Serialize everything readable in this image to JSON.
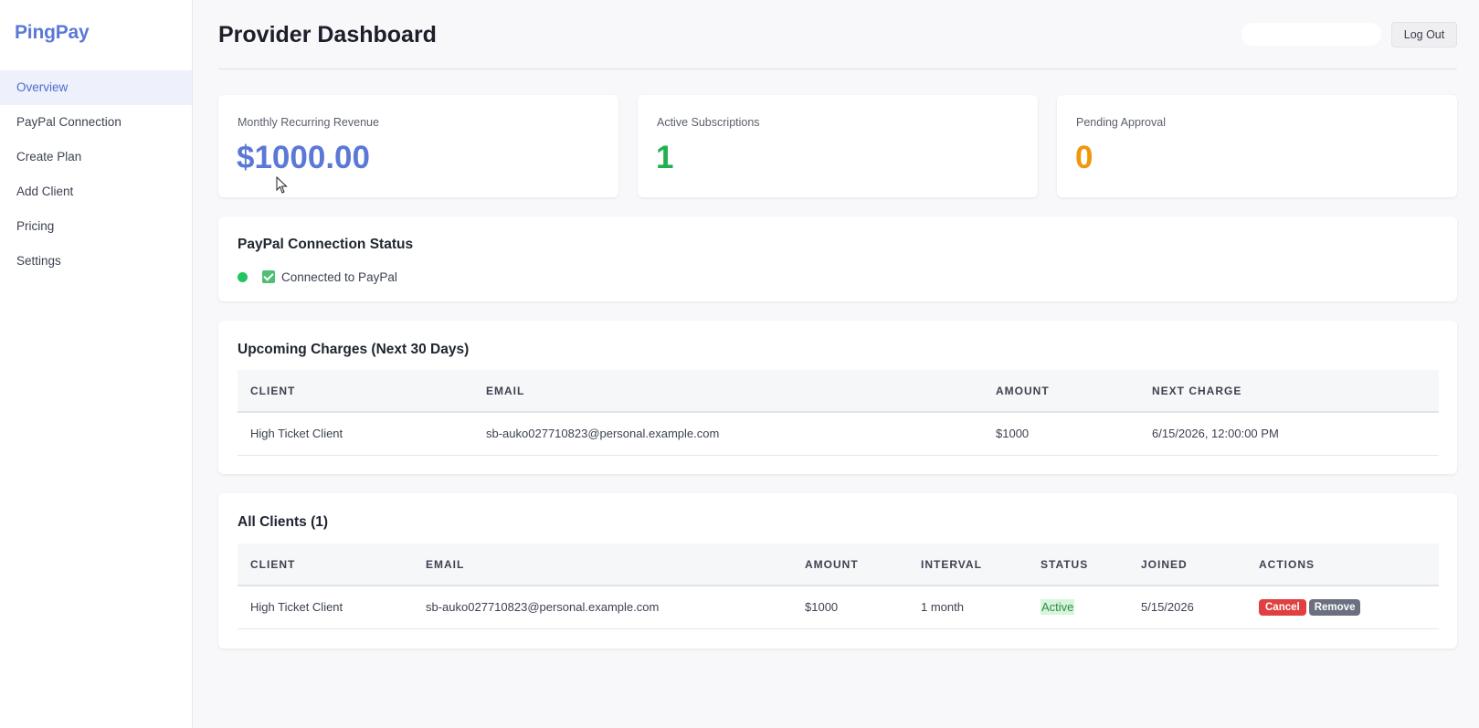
{
  "sidebar": {
    "brand": "PingPay",
    "items": [
      {
        "label": "Overview",
        "active": true
      },
      {
        "label": "PayPal Connection"
      },
      {
        "label": "Create Plan"
      },
      {
        "label": "Add Client"
      },
      {
        "label": "Pricing"
      },
      {
        "label": "Settings"
      }
    ]
  },
  "header": {
    "title": "Provider Dashboard",
    "logout_label": "Log Out"
  },
  "stats": [
    {
      "label": "Monthly Recurring Revenue",
      "value": "$1000.00",
      "color": "#5b78d8"
    },
    {
      "label": "Active Subscriptions",
      "value": "1",
      "color": "#22b04f"
    },
    {
      "label": "Pending Approval",
      "value": "0",
      "color": "#f0980c"
    }
  ],
  "paypal": {
    "title": "PayPal Connection Status",
    "status_text": "Connected to PayPal",
    "status_color": "#22c55e"
  },
  "upcoming": {
    "title": "Upcoming Charges (Next 30 Days)",
    "columns": [
      "CLIENT",
      "EMAIL",
      "AMOUNT",
      "NEXT CHARGE"
    ],
    "rows": [
      {
        "client": "High Ticket Client",
        "email": "sb-auko027710823@personal.example.com",
        "amount": "$1000",
        "next_charge": "6/15/2026, 12:00:00 PM"
      }
    ]
  },
  "clients": {
    "title": "All Clients (1)",
    "columns": [
      "CLIENT",
      "EMAIL",
      "AMOUNT",
      "INTERVAL",
      "STATUS",
      "JOINED",
      "ACTIONS"
    ],
    "rows": [
      {
        "client": "High Ticket Client",
        "email": "sb-auko027710823@personal.example.com",
        "amount": "$1000",
        "interval": "1 month",
        "status": "Active",
        "joined": "5/15/2026",
        "cancel_label": "Cancel",
        "remove_label": "Remove"
      }
    ]
  }
}
